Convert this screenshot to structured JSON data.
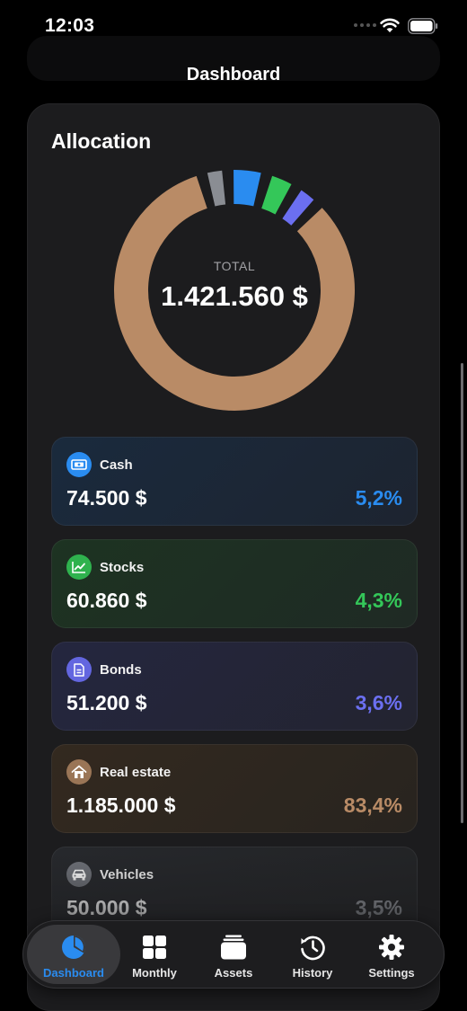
{
  "status_bar": {
    "time": "12:03"
  },
  "header": {
    "title": "Dashboard"
  },
  "allocation": {
    "title": "Allocation",
    "total_label": "TOTAL",
    "total_value": "1.421.560 $"
  },
  "assets": [
    {
      "name": "Cash",
      "value": "74.500 $",
      "percent": "5,2%",
      "share": 5.2,
      "icon": "banknote-icon",
      "color": "#2a8cf0",
      "icon_bg": "#2a8cf0"
    },
    {
      "name": "Stocks",
      "value": "60.860 $",
      "percent": "4,3%",
      "share": 4.3,
      "icon": "chart-line-icon",
      "color": "#34c759",
      "icon_bg": "#2fb24e"
    },
    {
      "name": "Bonds",
      "value": "51.200 $",
      "percent": "3,6%",
      "share": 3.6,
      "icon": "document-icon",
      "color": "#6b6ff0",
      "icon_bg": "#6366e0"
    },
    {
      "name": "Real estate",
      "value": "1.185.000 $",
      "percent": "83,4%",
      "share": 83.4,
      "icon": "house-icon",
      "color": "#b98b66",
      "icon_bg": "#9a7556"
    },
    {
      "name": "Vehicles",
      "value": "50.000 $",
      "percent": "3,5%",
      "share": 3.5,
      "icon": "car-icon",
      "color": "#8a8d93",
      "icon_bg": "#6d7077"
    }
  ],
  "tabs": [
    {
      "label": "Dashboard",
      "icon": "pie-chart-icon",
      "active": true
    },
    {
      "label": "Monthly",
      "icon": "grid-icon",
      "active": false
    },
    {
      "label": "Assets",
      "icon": "stack-icon",
      "active": false
    },
    {
      "label": "History",
      "icon": "history-icon",
      "active": false
    },
    {
      "label": "Settings",
      "icon": "gear-icon",
      "active": false
    }
  ]
}
